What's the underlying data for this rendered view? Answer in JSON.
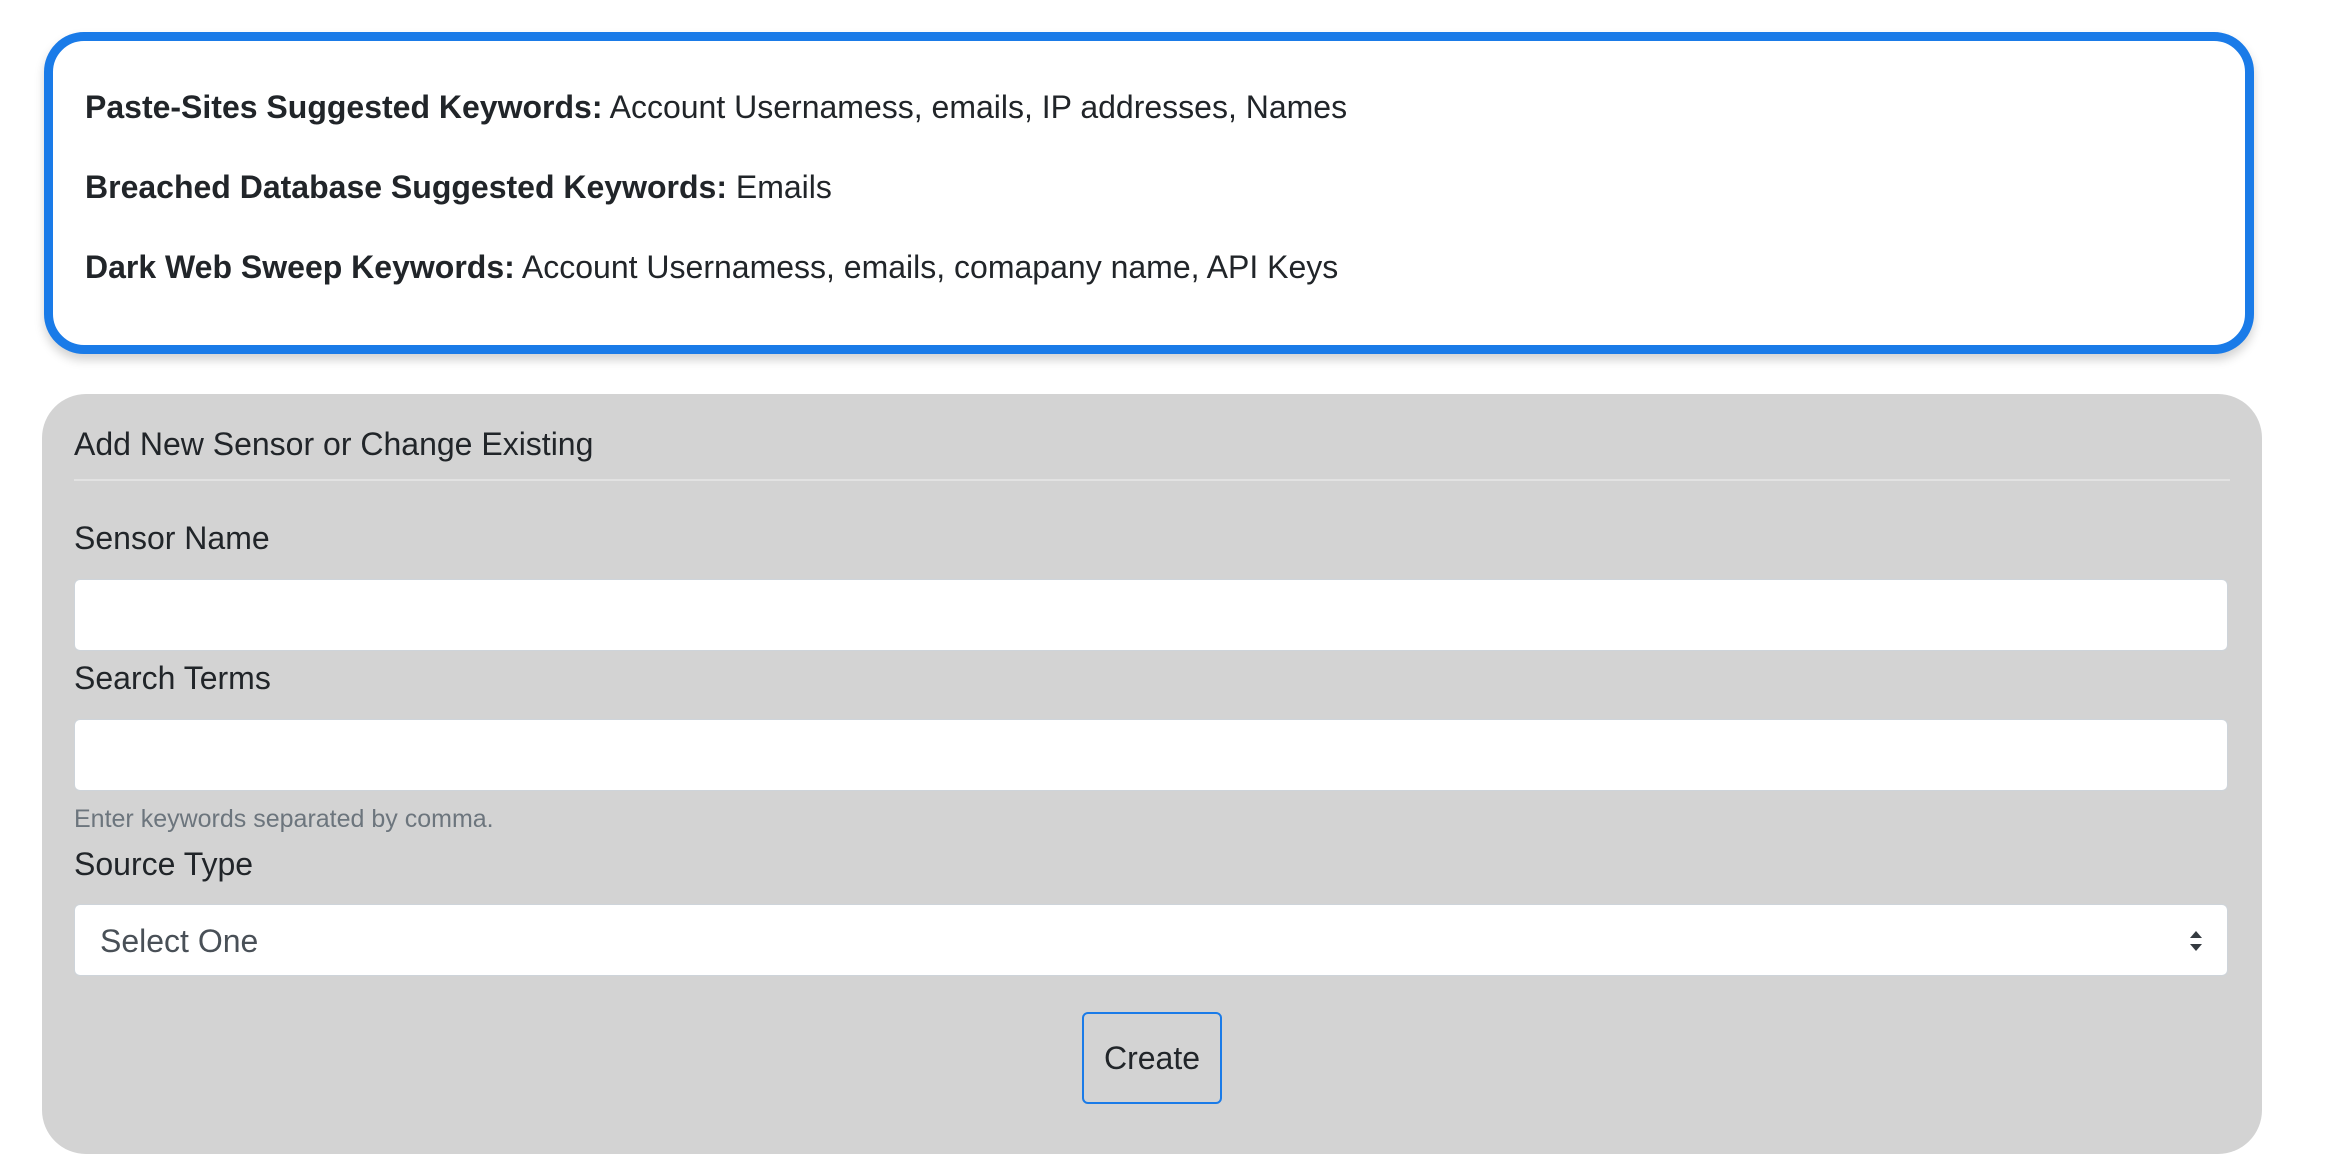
{
  "keywords": {
    "paste_sites": {
      "label": "Paste-Sites Suggested Keywords:",
      "value": "Account Usernamess, emails, IP addresses, Names"
    },
    "breached_db": {
      "label": "Breached Database Suggested Keywords:",
      "value": "Emails"
    },
    "dark_web": {
      "label": "Dark Web Sweep Keywords:",
      "value": "Account Usernamess, emails, comapany name, API Keys"
    }
  },
  "form": {
    "title": "Add New Sensor or Change Existing",
    "sensor_name": {
      "label": "Sensor Name",
      "value": "",
      "placeholder": ""
    },
    "search_terms": {
      "label": "Search Terms",
      "value": "",
      "placeholder": "",
      "help": "Enter keywords separated by comma."
    },
    "source_type": {
      "label": "Source Type",
      "selected": "Select One"
    },
    "create_label": "Create"
  },
  "colors": {
    "accent": "#1a7be8",
    "form_bg": "#d3d3d3",
    "help_text": "#6c757d"
  }
}
